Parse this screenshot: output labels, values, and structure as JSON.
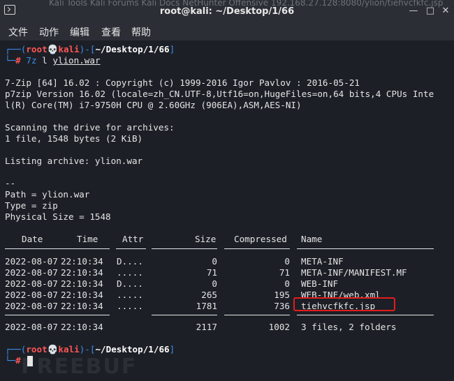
{
  "window": {
    "title": "root@kali: ~/Desktop/1/66",
    "background_tabs": "Kali Tools   Kali Forums   Kali Docs   NetHunter   Offensive   192.168.27.128:8080/ylion/tiehvcfkfc.jsp"
  },
  "menu": [
    "文件",
    "动作",
    "编辑",
    "查看",
    "帮助"
  ],
  "prompt": {
    "user": "root",
    "skull": "💀",
    "host": "kali",
    "path": "~/Desktop/1/66",
    "symbol": "#"
  },
  "command": {
    "name": "7z",
    "sub": "l",
    "arg": "ylion.war"
  },
  "output": {
    "banner1": "7-Zip [64] 16.02 : Copyright (c) 1999-2016 Igor Pavlov : 2016-05-21",
    "banner2": "p7zip Version 16.02 (locale=zh_CN.UTF-8,Utf16=on,HugeFiles=on,64 bits,4 CPUs Inte",
    "banner3": "l(R) Core(TM) i7-9750H CPU @ 2.60GHz (906EA),ASM,AES-NI)",
    "scan1": "Scanning the drive for archives:",
    "scan2": "1 file, 1548 bytes (2 KiB)",
    "listing": "Listing archive: ylion.war",
    "separator": "--",
    "path": "Path = ylion.war",
    "type": "Type = zip",
    "physical_size": "Physical Size = 1548"
  },
  "table": {
    "headers": [
      "Date",
      "Time",
      "Attr",
      "Size",
      "Compressed",
      "Name"
    ],
    "rows": [
      {
        "date": "2022-08-07",
        "time": "22:10:34",
        "attr": "D....",
        "size": "0",
        "compressed": "0",
        "name": "META-INF"
      },
      {
        "date": "2022-08-07",
        "time": "22:10:34",
        "attr": ".....",
        "size": "71",
        "compressed": "71",
        "name": "META-INF/MANIFEST.MF"
      },
      {
        "date": "2022-08-07",
        "time": "22:10:34",
        "attr": "D....",
        "size": "0",
        "compressed": "0",
        "name": "WEB-INF"
      },
      {
        "date": "2022-08-07",
        "time": "22:10:34",
        "attr": ".....",
        "size": "265",
        "compressed": "195",
        "name": "WEB-INF/web.xml"
      },
      {
        "date": "2022-08-07",
        "time": "22:10:34",
        "attr": ".....",
        "size": "1781",
        "compressed": "736",
        "name": "tiehvcfkfc.jsp"
      }
    ],
    "summary": {
      "date": "2022-08-07",
      "time": "22:10:34",
      "size": "2117",
      "compressed": "1002",
      "name": "3 files, 2 folders"
    }
  },
  "watermark": "FREEBUF",
  "colors": {
    "terminal_bg": "#1c1f26",
    "prompt_blue": "#3b8eea",
    "prompt_red": "#ff5555",
    "highlight_red": "#e11d1d"
  }
}
